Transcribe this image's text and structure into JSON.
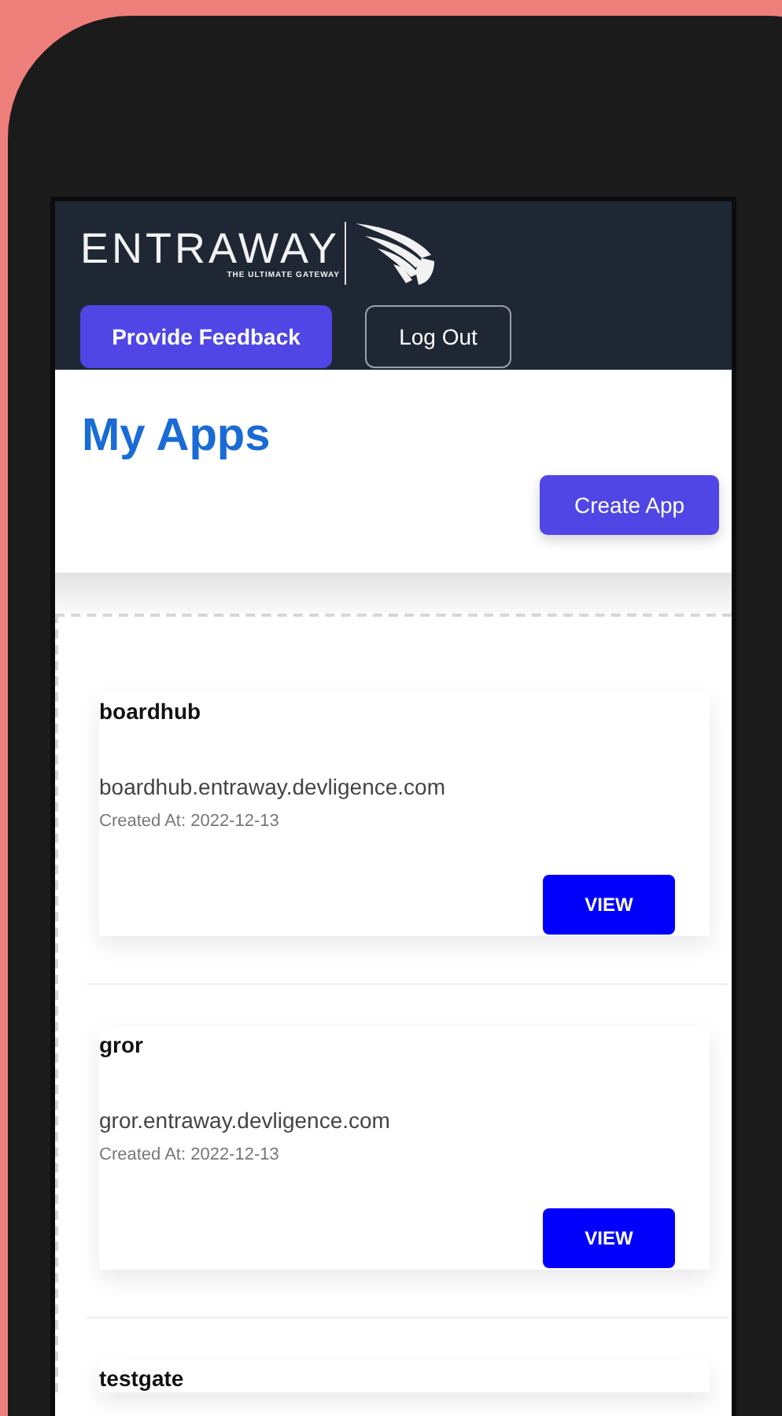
{
  "header": {
    "logo": {
      "name": "ENTRAWAY",
      "tagline": "THE ULTIMATE GATEWAY"
    },
    "buttons": [
      {
        "label": "Provide Feedback",
        "kind": "primary"
      },
      {
        "label": "Log Out",
        "kind": "outline"
      }
    ]
  },
  "page": {
    "title": "My Apps",
    "create_button": "Create App"
  },
  "apps": [
    {
      "name": "boardhub",
      "url": "boardhub.entraway.devligence.com",
      "created": "Created At: 2022-12-13",
      "button": "VIEW"
    },
    {
      "name": "gror",
      "url": "gror.entraway.devligence.com",
      "created": "Created At: 2022-12-13",
      "button": "VIEW"
    },
    {
      "name": "testgate"
    }
  ]
}
